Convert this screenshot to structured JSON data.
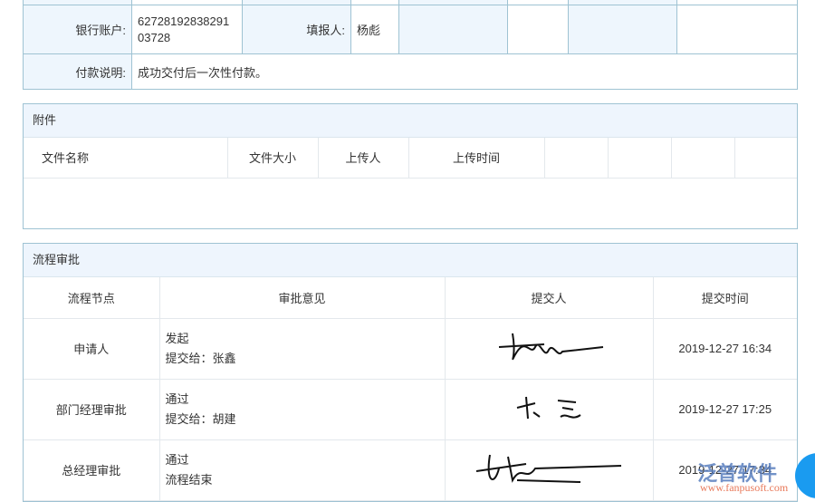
{
  "info": {
    "bank_label": "银行账户:",
    "bank_value": "62728192838291\n03728",
    "filler_label": "填报人:",
    "filler_value": "杨彪",
    "payment_label": "付款说明:",
    "payment_value": "成功交付后一次性付款。"
  },
  "attachments": {
    "title": "附件",
    "columns": [
      "文件名称",
      "文件大小",
      "上传人",
      "上传时间"
    ]
  },
  "approval": {
    "title": "流程审批",
    "columns": [
      "流程节点",
      "审批意见",
      "提交人",
      "提交时间"
    ],
    "rows": [
      {
        "node": "申请人",
        "opinion": "发起",
        "next": "提交给：张鑫",
        "signature": "杨彪",
        "time": "2019-12-27 16:34"
      },
      {
        "node": "部门经理审批",
        "opinion": "通过",
        "next": "提交给：胡建",
        "signature": "张鑫",
        "time": "2019-12-27 17:25"
      },
      {
        "node": "总经理审批",
        "opinion": "通过",
        "next": "流程结束",
        "signature": "胡建",
        "time": "2019-12-27 17:34"
      }
    ]
  },
  "watermark": {
    "brand": "泛普软件",
    "url": "www.fanpusoft.com"
  }
}
